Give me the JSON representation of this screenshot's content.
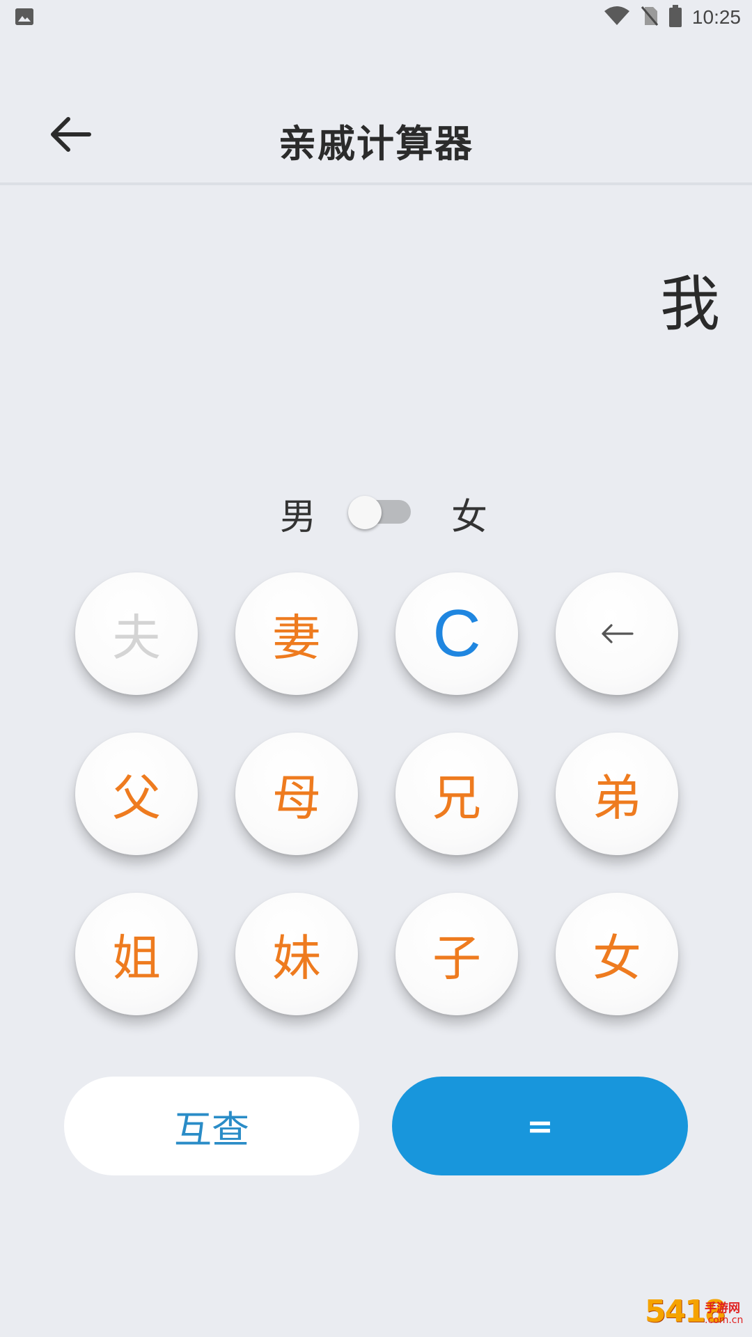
{
  "status_bar": {
    "time": "10:25",
    "icons": [
      "gallery-icon",
      "wifi-icon",
      "no-sim-icon",
      "battery-icon"
    ]
  },
  "header": {
    "title": "亲戚计算器",
    "back_icon": "arrow-left-icon"
  },
  "display": {
    "text": "我"
  },
  "gender": {
    "male_label": "男",
    "female_label": "女",
    "selected": "男"
  },
  "keypad": {
    "keys": [
      {
        "label": "夫",
        "state": "disabled"
      },
      {
        "label": "妻",
        "state": "enabled"
      },
      {
        "label": "C",
        "state": "clear"
      },
      {
        "label": "←",
        "state": "backspace"
      },
      {
        "label": "父",
        "state": "enabled"
      },
      {
        "label": "母",
        "state": "enabled"
      },
      {
        "label": "兄",
        "state": "enabled"
      },
      {
        "label": "弟",
        "state": "enabled"
      },
      {
        "label": "姐",
        "state": "enabled"
      },
      {
        "label": "妹",
        "state": "enabled"
      },
      {
        "label": "子",
        "state": "enabled"
      },
      {
        "label": "女",
        "state": "enabled"
      }
    ]
  },
  "actions": {
    "mutual_label": "互查",
    "equals_label": "="
  },
  "watermark": {
    "number": "5418",
    "site": "手游网",
    "domain": ".com.cn"
  },
  "colors": {
    "background": "#eaecf1",
    "key_text": "#ee7b1f",
    "key_disabled": "#d4d4d4",
    "clear_text": "#1f86e0",
    "primary_button": "#1896dc",
    "mutual_text": "#2a8cc7"
  }
}
